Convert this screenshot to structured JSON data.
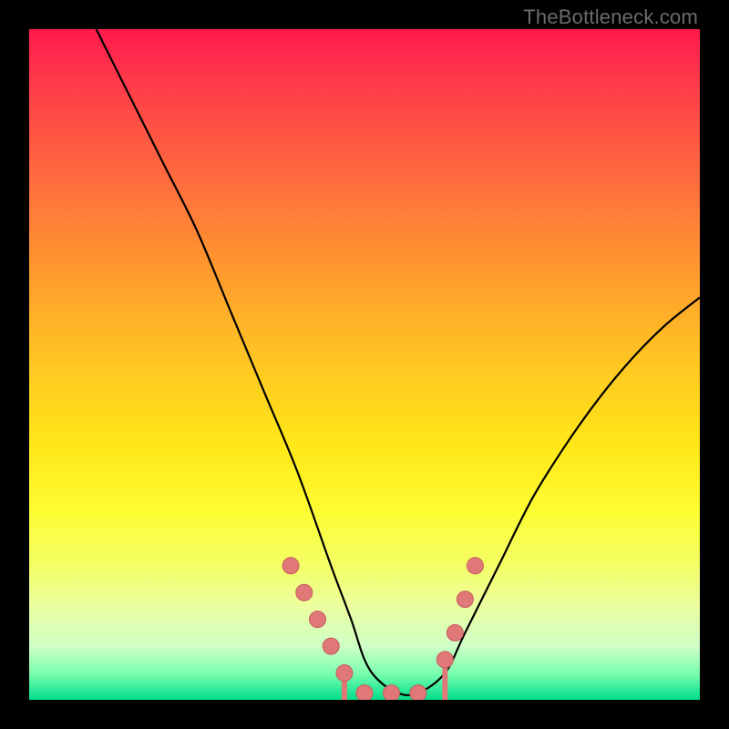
{
  "watermark": "TheBottleneck.com",
  "chart_data": {
    "type": "line",
    "title": "",
    "xlabel": "",
    "ylabel": "",
    "ylim": [
      0,
      100
    ],
    "xlim": [
      0,
      100
    ],
    "series": [
      {
        "name": "bottleneck-curve",
        "x": [
          10,
          15,
          20,
          25,
          30,
          35,
          40,
          45,
          48,
          50,
          52,
          55,
          58,
          62,
          65,
          70,
          75,
          80,
          85,
          90,
          95,
          100
        ],
        "y": [
          100,
          90,
          80,
          70,
          58,
          46,
          34,
          20,
          12,
          6,
          3,
          1,
          1,
          4,
          10,
          20,
          30,
          38,
          45,
          51,
          56,
          60
        ]
      }
    ],
    "markers": {
      "name": "highlight-dots",
      "x": [
        39,
        41,
        43,
        45,
        47,
        50,
        54,
        58,
        62,
        63.5,
        65,
        66.5
      ],
      "y": [
        20,
        16,
        12,
        8,
        4,
        1,
        1,
        1,
        6,
        10,
        15,
        20
      ]
    },
    "colors": {
      "curve": "#000000",
      "marker_fill": "#e07878",
      "marker_stroke": "#c55c5c",
      "gradient_top": "#ff1a4d",
      "gradient_bottom": "#00de8a",
      "frame": "#000000"
    }
  }
}
